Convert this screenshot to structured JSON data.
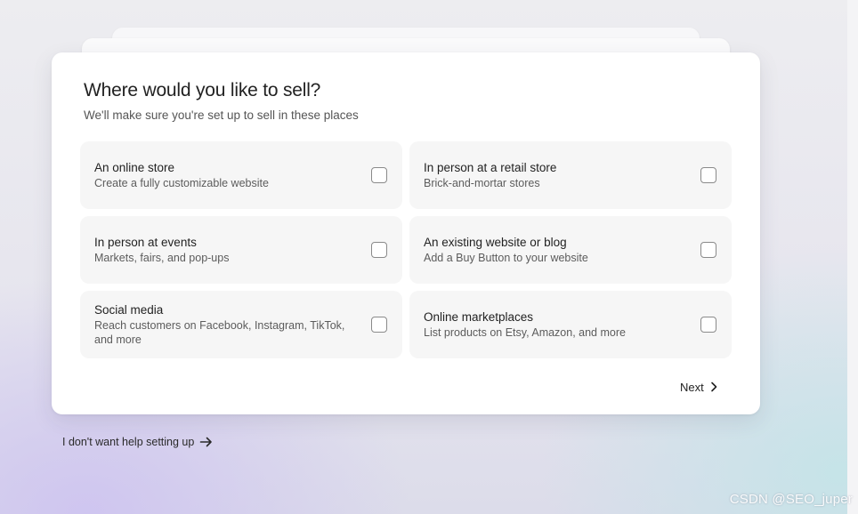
{
  "card": {
    "title": "Where would you like to sell?",
    "subtitle": "We'll make sure you're set up to sell in these places"
  },
  "options": [
    {
      "title": "An online store",
      "description": "Create a fully customizable website",
      "checked": false
    },
    {
      "title": "In person at a retail store",
      "description": "Brick-and-mortar stores",
      "checked": false
    },
    {
      "title": "In person at events",
      "description": "Markets, fairs, and pop-ups",
      "checked": false
    },
    {
      "title": "An existing website or blog",
      "description": "Add a Buy Button to your website",
      "checked": false
    },
    {
      "title": "Social media",
      "description": "Reach customers on Facebook, Instagram, TikTok, and more",
      "checked": false
    },
    {
      "title": "Online marketplaces",
      "description": "List products on Etsy, Amazon, and more",
      "checked": false
    }
  ],
  "actions": {
    "next_label": "Next",
    "next_icon": "chevron-right-icon",
    "skip_label": "I don't want help setting up",
    "skip_icon": "arrow-right-icon"
  },
  "watermark": "CSDN @SEO_juper",
  "colors": {
    "card_bg": "#ffffff",
    "option_bg": "#f6f6f6",
    "text_primary": "#222222",
    "text_secondary": "#5c5c5c",
    "checkbox_border": "#8a8a8a"
  }
}
